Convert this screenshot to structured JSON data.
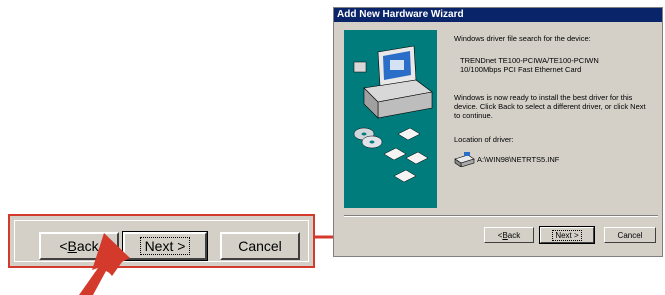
{
  "zoom_buttons": {
    "back_prefix": "< ",
    "back_underline": "B",
    "back_rest": "ack",
    "next_label": "Next >",
    "cancel_label": "Cancel"
  },
  "dialog": {
    "title": "Add New Hardware Wizard",
    "intro": "Windows driver file search for the device:",
    "device_line1": "TRENDnet TE100-PCIWA/TE100-PCIWN",
    "device_line2": "10/100Mbps PCI Fast Ethernet Card",
    "ready_line1": "Windows is now ready to install the best driver for this",
    "ready_line2": "device. Click Back to select a different driver, or click Next",
    "ready_line3": "to continue.",
    "location_label": "Location of driver:",
    "driver_path": "A:\\WIN98\\NETRTS5.INF",
    "back_prefix": "< ",
    "back_underline": "B",
    "back_rest": "ack",
    "next_label": "Next >",
    "cancel_label": "Cancel"
  },
  "colors": {
    "callout_red": "#d33a2c",
    "titlebar_blue": "#0a246a",
    "graphic_teal": "#007c7c",
    "face_gray": "#d4d0c8"
  },
  "icons": [
    "computer-icon",
    "cd-disk-icon",
    "floppy-disk-icon",
    "drive-icon",
    "pointer-arrow-icon"
  ]
}
